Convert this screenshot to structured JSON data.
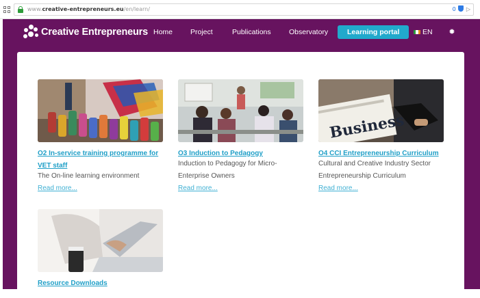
{
  "browser": {
    "url_prefix": "www.",
    "url_domain": "creative-entrepreneurs.eu",
    "url_path": "/en/learn/",
    "ext_badge": "0"
  },
  "nav": {
    "logo_text": "Creative Entrepreneurs",
    "links": [
      "Home",
      "Project",
      "Publications",
      "Observatory"
    ],
    "active_link": "Learning portal",
    "language": "EN",
    "accent_color": "#21a9cc",
    "background_color": "#67135f"
  },
  "items": [
    {
      "title_line1": "O2 In-service training programme for",
      "title_line2": "VET staff",
      "desc_line1": "The On-line learning environment",
      "desc_line2": "",
      "more": "Read more..."
    },
    {
      "title_line1": "O3 Induction to Pedagogy",
      "title_line2": "",
      "desc_line1": "Induction to Pedagogy for Micro-",
      "desc_line2": "Enterprise Owners",
      "more": "Read more..."
    },
    {
      "title_line1": "O4 CCI Entrepreneurship Curriculum",
      "title_line2": "",
      "desc_line1": "Cultural and Creative Industry Sector",
      "desc_line2": "Entrepreneurship Curriculum",
      "more": "Read more...",
      "image_text": "Business"
    },
    {
      "title_line1": "Resource Downloads",
      "title_line2": "",
      "desc_line1": "",
      "desc_line2": "",
      "more": ""
    }
  ]
}
